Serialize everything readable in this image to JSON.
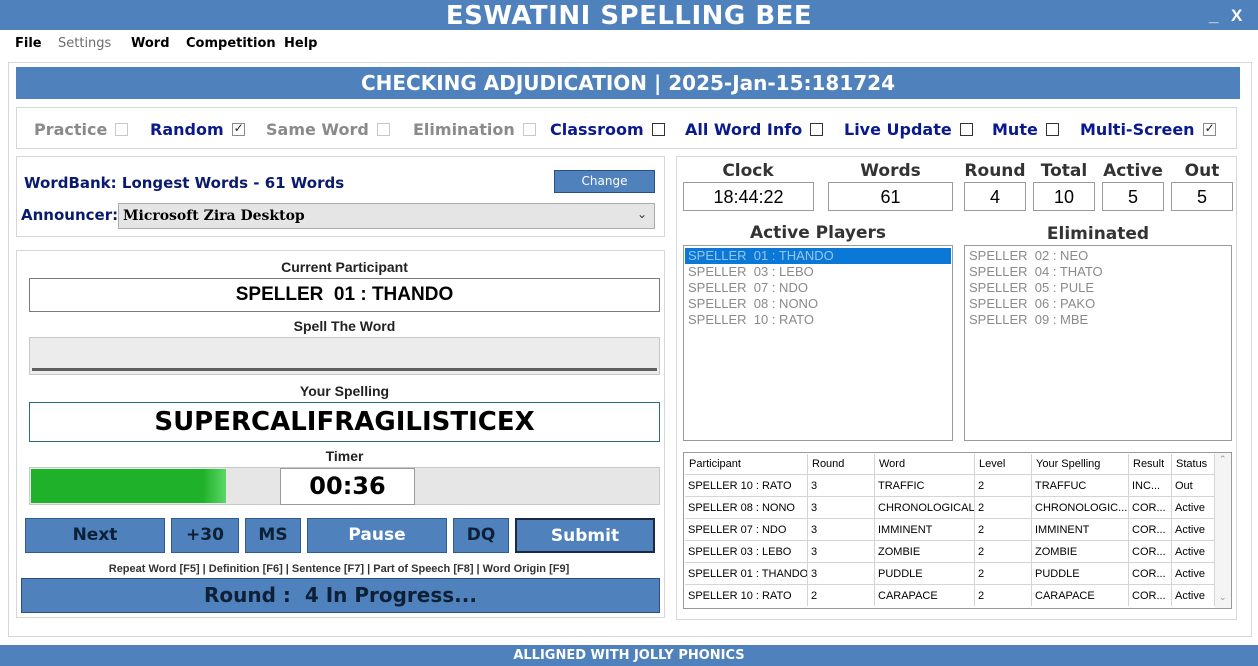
{
  "window": {
    "title": "ESWATINI SPELLING BEE",
    "minimize": "_",
    "close": "X"
  },
  "menu": [
    "File",
    "Settings",
    "Word",
    "Competition",
    "Help"
  ],
  "header": {
    "title": "CHECKING ADJUDICATION | 2025-Jan-15:181724"
  },
  "options": [
    {
      "label": "Practice",
      "checked": false,
      "enabled": false
    },
    {
      "label": "Random",
      "checked": true,
      "enabled": true
    },
    {
      "label": "Same Word",
      "checked": false,
      "enabled": false
    },
    {
      "label": "Elimination",
      "checked": false,
      "enabled": false
    },
    {
      "label": "Classroom",
      "checked": false,
      "enabled": true
    },
    {
      "label": "All Word Info",
      "checked": false,
      "enabled": true
    },
    {
      "label": "Live Update",
      "checked": false,
      "enabled": true
    },
    {
      "label": "Mute",
      "checked": false,
      "enabled": true
    },
    {
      "label": "Multi-Screen",
      "checked": true,
      "enabled": true
    }
  ],
  "wordbank": {
    "label": "WordBank: Longest Words - 61 Words",
    "change_label": "Change"
  },
  "announcer": {
    "label": "Announcer:",
    "value": "Microsoft Zira Desktop"
  },
  "participant": {
    "current_label": "Current Participant",
    "current_value": "SPELLER  01 : THANDO",
    "spell_label": "Spell The Word",
    "spell_value": "",
    "your_spelling_label": "Your Spelling",
    "your_spelling_value": "SUPERCALIFRAGILISTICEX",
    "timer_label": "Timer",
    "timer_value": "00:36",
    "timer_progress": 0.31
  },
  "buttons": {
    "next": "Next",
    "plus30": "+30",
    "ms": "MS",
    "pause": "Pause",
    "dq": "DQ",
    "submit": "Submit"
  },
  "shortcuts": "Repeat Word [F5] | Definition [F6] | Sentence [F7] | Part of Speech [F8] | Word Origin [F9]",
  "round_status": "Round :  4 In Progress...",
  "stats": {
    "clock_label": "Clock",
    "clock_value": "18:44:22",
    "words_label": "Words",
    "words_value": "61",
    "round_label": "Round",
    "round_value": "4",
    "total_label": "Total",
    "total_value": "10",
    "active_label": "Active",
    "active_value": "5",
    "out_label": "Out",
    "out_value": "5"
  },
  "active_players": {
    "label": "Active Players",
    "items": [
      "SPELLER  01 : THANDO",
      "SPELLER  03 : LEBO",
      "SPELLER  07 : NDO",
      "SPELLER  08 : NONO",
      "SPELLER  10 : RATO"
    ]
  },
  "eliminated": {
    "label": "Eliminated",
    "items": [
      "SPELLER  02 : NEO",
      "SPELLER  04 : THATO",
      "SPELLER  05 : PULE",
      "SPELLER  06 : PAKO",
      "SPELLER  09 : MBE"
    ]
  },
  "results": {
    "columns": [
      "Participant",
      "Round",
      "Word",
      "Level",
      "Your Spelling",
      "Result",
      "Status"
    ],
    "rows": [
      [
        "SPELLER  10 : RATO",
        "3",
        "TRAFFIC",
        "2",
        "TRAFFUC",
        "INC...",
        "Out"
      ],
      [
        "SPELLER  08 : NONO",
        "3",
        "CHRONOLOGICAL",
        "2",
        "CHRONOLOGIC...",
        "COR...",
        "Active"
      ],
      [
        "SPELLER  07 : NDO",
        "3",
        "IMMINENT",
        "2",
        "IMMINENT",
        "COR...",
        "Active"
      ],
      [
        "SPELLER  03 : LEBO",
        "3",
        "ZOMBIE",
        "2",
        "ZOMBIE",
        "COR...",
        "Active"
      ],
      [
        "SPELLER  01 : THANDO",
        "3",
        "PUDDLE",
        "2",
        "PUDDLE",
        "COR...",
        "Active"
      ],
      [
        "SPELLER  10 : RATO",
        "2",
        "CARAPACE",
        "2",
        "CARAPACE",
        "COR...",
        "Active"
      ]
    ]
  },
  "footer": "ALLIGNED WITH JOLLY PHONICS",
  "colors": {
    "accent": "#4f81bd",
    "timer_fill": "#1fb12a",
    "selection": "#0a78d7",
    "navy": "#0a1a8c"
  }
}
